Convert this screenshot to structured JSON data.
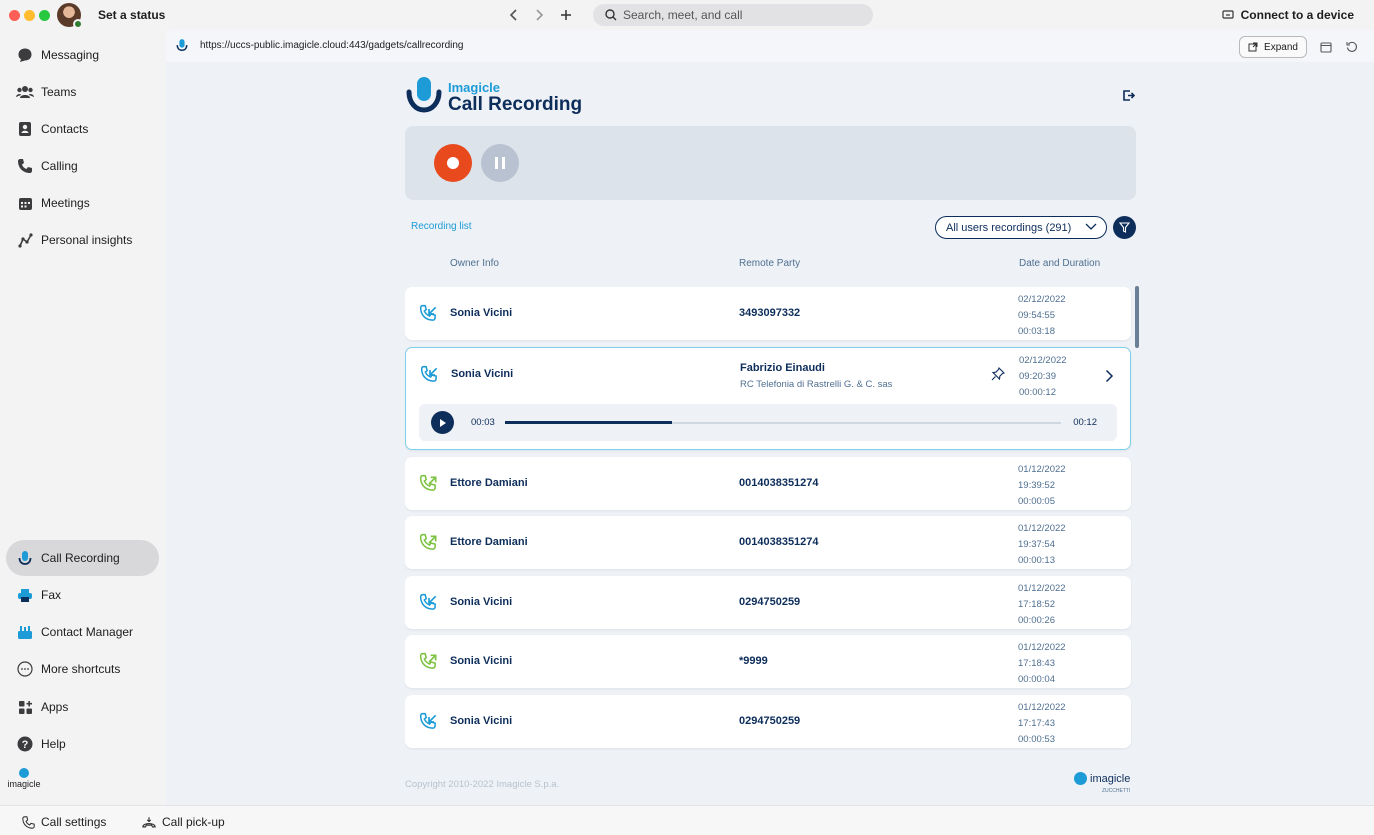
{
  "titlebar": {
    "status_label": "Set a status",
    "search_placeholder": "Search, meet, and call",
    "connect_label": "Connect to a device"
  },
  "sidebar": {
    "items": [
      {
        "label": "Messaging",
        "icon": "chat-bubble-icon"
      },
      {
        "label": "Teams",
        "icon": "people-icon"
      },
      {
        "label": "Contacts",
        "icon": "contacts-icon"
      },
      {
        "label": "Calling",
        "icon": "phone-icon"
      },
      {
        "label": "Meetings",
        "icon": "calendar-icon"
      },
      {
        "label": "Personal insights",
        "icon": "insights-icon"
      }
    ],
    "shortcuts": [
      {
        "label": "Call Recording",
        "icon": "microphone-icon",
        "active": true
      },
      {
        "label": "Fax",
        "icon": "printer-icon"
      },
      {
        "label": "Contact Manager",
        "icon": "contact-manager-icon"
      },
      {
        "label": "More shortcuts",
        "icon": "ellipsis-icon"
      },
      {
        "label": "Apps",
        "icon": "apps-icon"
      },
      {
        "label": "Help",
        "icon": "help-icon"
      }
    ],
    "brand": "imagicle"
  },
  "bottombar": {
    "call_settings": "Call settings",
    "call_pickup": "Call pick-up"
  },
  "urlbar": {
    "url": "https://uccs-public.imagicle.cloud:443/gadgets/callrecording",
    "expand_label": "Expand"
  },
  "gadget": {
    "brand": "Imagicle",
    "product": "Call Recording",
    "recording_list_link": "Recording list",
    "users_select": "All users recordings (291)",
    "columns": {
      "owner": "Owner Info",
      "remote": "Remote Party",
      "date": "Date and Duration"
    },
    "rows": [
      {
        "owner": "Sonia Vicini",
        "remote": "3493097332",
        "remote_sub": "",
        "date": "02/12/2022",
        "time": "09:54:55",
        "duration": "00:03:18",
        "direction": "incoming"
      },
      {
        "owner": "Sonia Vicini",
        "remote": "Fabrizio Einaudi",
        "remote_sub": "RC Telefonia di Rastrelli G. & C. sas",
        "date": "02/12/2022",
        "time": "09:20:39",
        "duration": "00:00:12",
        "direction": "incoming",
        "expanded": true
      },
      {
        "owner": "Ettore Damiani",
        "remote": "0014038351274",
        "remote_sub": "",
        "date": "01/12/2022",
        "time": "19:39:52",
        "duration": "00:00:05",
        "direction": "outgoing"
      },
      {
        "owner": "Ettore Damiani",
        "remote": "0014038351274",
        "remote_sub": "",
        "date": "01/12/2022",
        "time": "19:37:54",
        "duration": "00:00:13",
        "direction": "outgoing"
      },
      {
        "owner": "Sonia Vicini",
        "remote": "0294750259",
        "remote_sub": "",
        "date": "01/12/2022",
        "time": "17:18:52",
        "duration": "00:00:26",
        "direction": "incoming"
      },
      {
        "owner": "Sonia Vicini",
        "remote": "*9999",
        "remote_sub": "",
        "date": "01/12/2022",
        "time": "17:18:43",
        "duration": "00:00:04",
        "direction": "outgoing"
      },
      {
        "owner": "Sonia Vicini",
        "remote": "0294750259",
        "remote_sub": "",
        "date": "01/12/2022",
        "time": "17:17:43",
        "duration": "00:00:53",
        "direction": "incoming"
      }
    ],
    "player": {
      "current": "00:03",
      "total": "00:12",
      "progress": 0.3
    },
    "copyright": "Copyright 2010-2022 Imagicle S.p.a.",
    "footer_brand": "imagicle",
    "footer_sub": "ZUCCHETTI"
  },
  "colors": {
    "accent": "#1d9bd7",
    "navy": "#0d2d5a",
    "record": "#e8491d",
    "incoming": "#1d9bd7",
    "outgoing": "#7cc242"
  }
}
